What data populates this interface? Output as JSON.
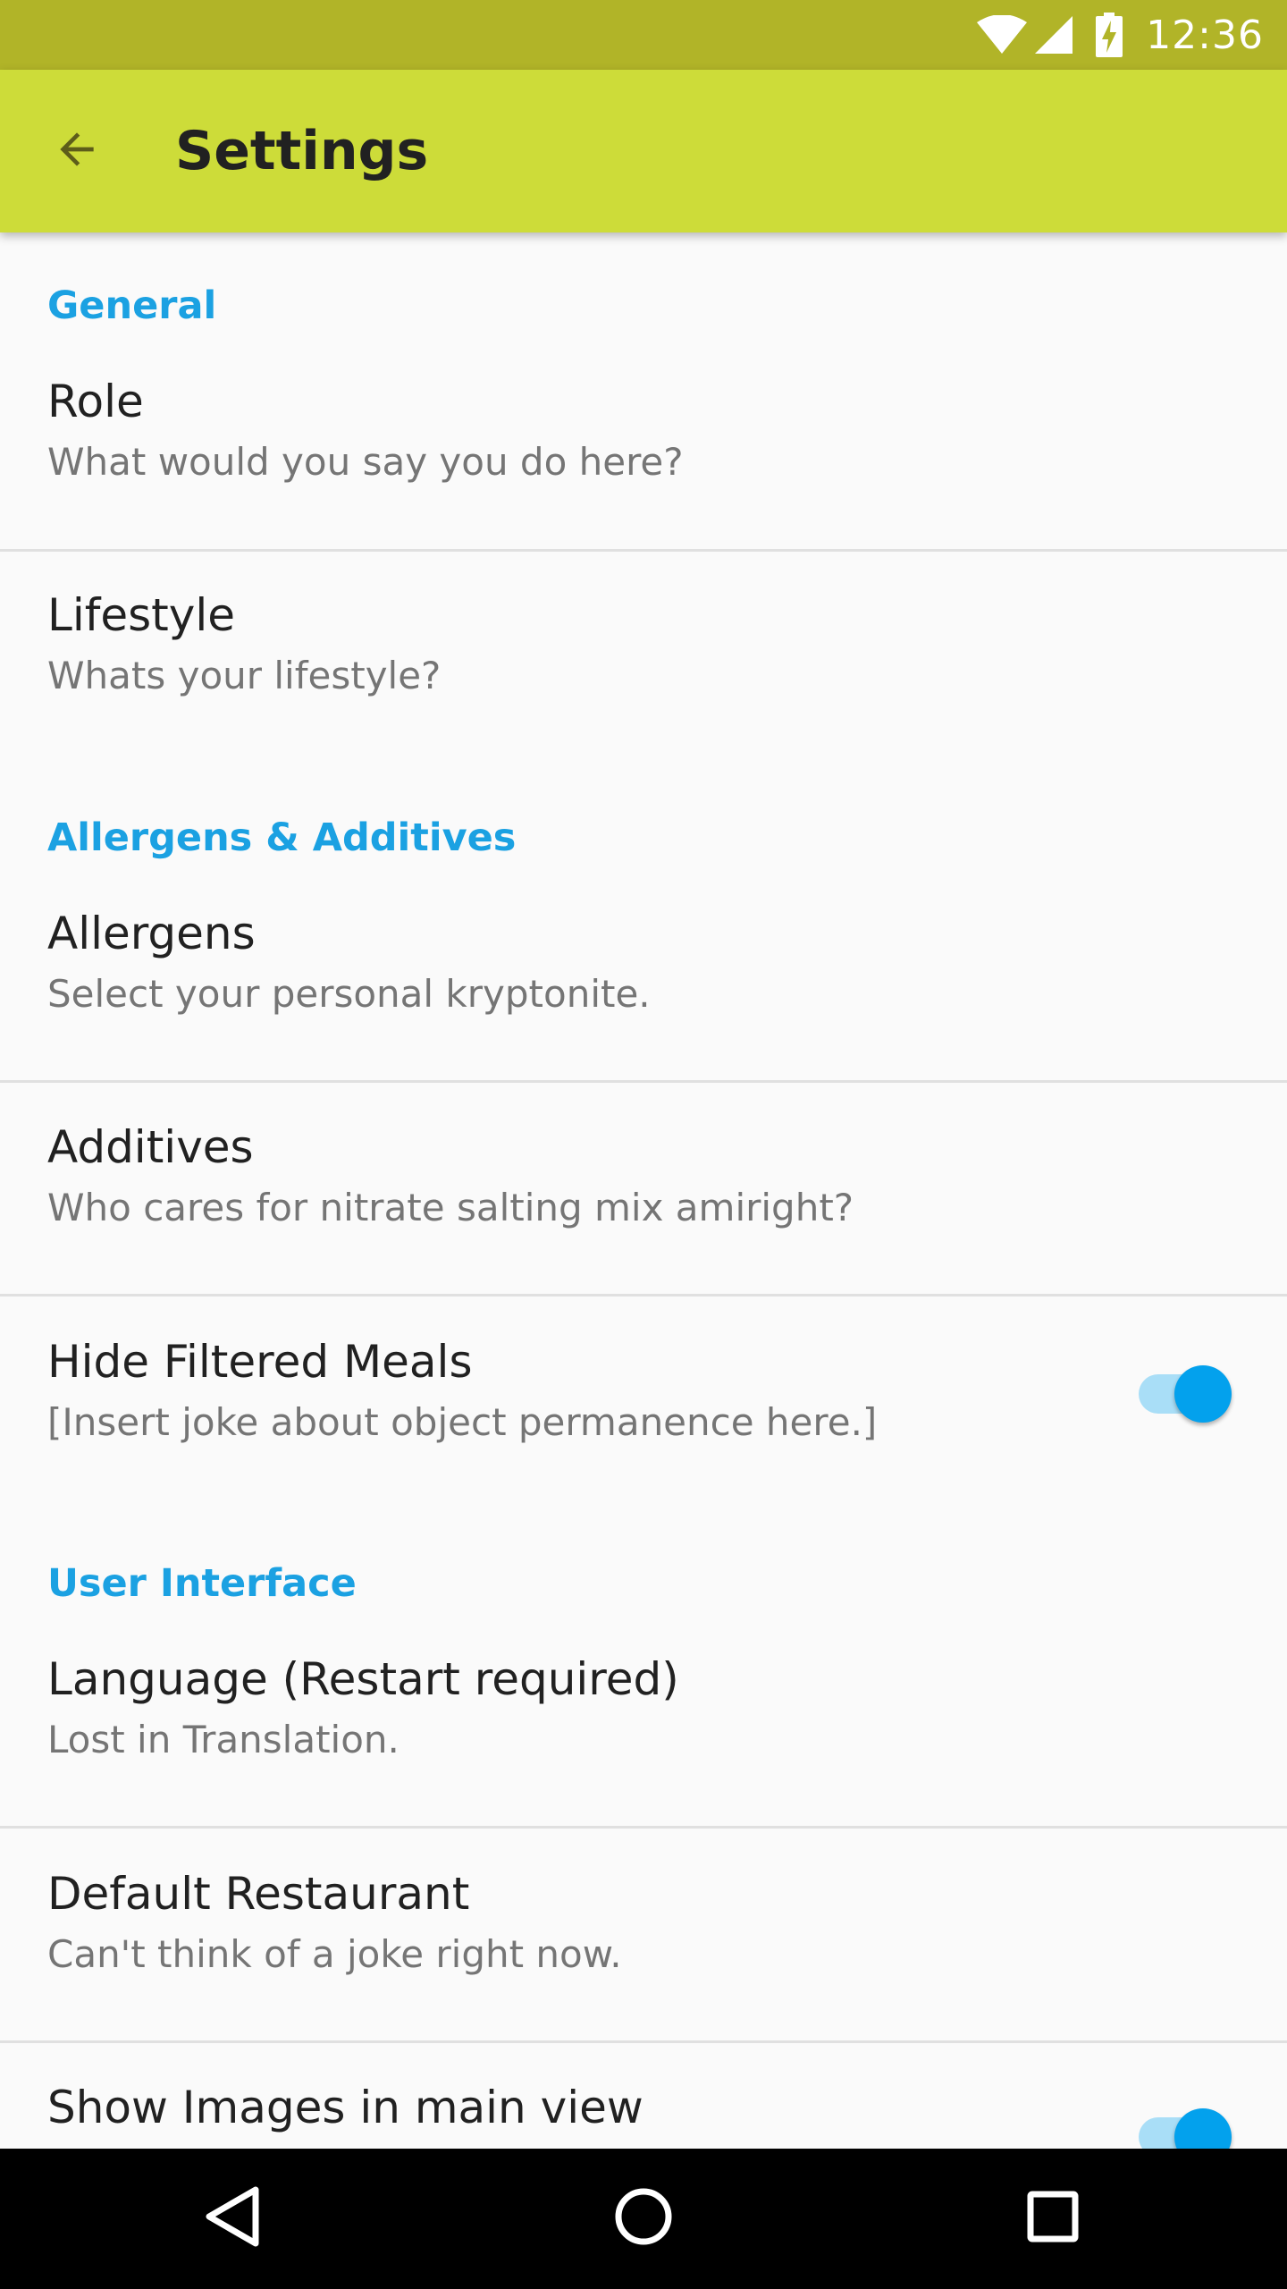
{
  "status_bar": {
    "time": "12:36",
    "icons": [
      "wifi-icon",
      "signal-icon",
      "battery-charging-icon"
    ]
  },
  "app_bar": {
    "title": "Settings",
    "back_icon": "arrow-back-icon"
  },
  "colors": {
    "status_bar": "#b1b428",
    "app_bar": "#cddc39",
    "accent": "#1ba1e2",
    "switch_thumb": "#03a1ed",
    "switch_track": "#a9def7",
    "background": "#fafafa"
  },
  "sections": {
    "general": {
      "header": "General",
      "role": {
        "title": "Role",
        "summary": "What would you say you do here?"
      },
      "lifestyle": {
        "title": "Lifestyle",
        "summary": "Whats your lifestyle?"
      }
    },
    "allergens": {
      "header": "Allergens & Additives",
      "allergens": {
        "title": "Allergens",
        "summary": "Select your personal kryptonite."
      },
      "additives": {
        "title": "Additives",
        "summary": "Who cares for nitrate salting mix amiright?"
      },
      "hide_filtered": {
        "title": "Hide Filtered Meals",
        "summary": "[Insert joke about object permanence here.]",
        "enabled": true
      }
    },
    "ui": {
      "header": "User Interface",
      "language": {
        "title": "Language (Restart required)",
        "summary": "Lost in Translation."
      },
      "default_restaurant": {
        "title": "Default Restaurant",
        "summary": "Can't think of a joke right now."
      },
      "show_images": {
        "title": "Show Images in main view",
        "enabled": true
      }
    }
  },
  "nav_bar": {
    "icons": [
      "back-triangle-icon",
      "home-circle-icon",
      "recents-square-icon"
    ]
  }
}
